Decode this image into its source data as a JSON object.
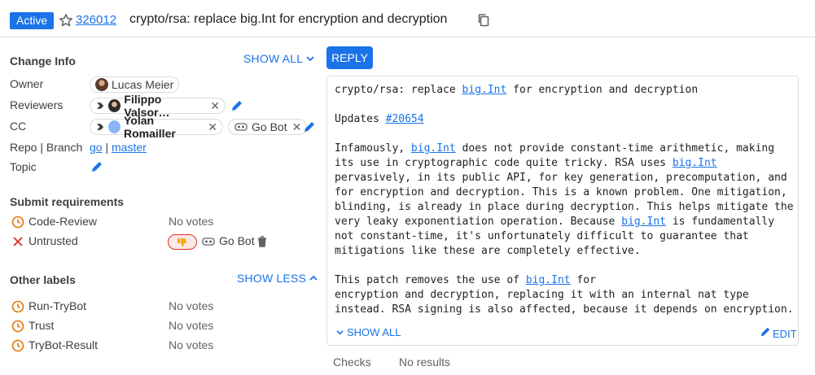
{
  "header": {
    "status": "Active",
    "change_number": "326012",
    "subject": "crypto/rsa: replace big.Int for encryption and decryption"
  },
  "change_info": {
    "title": "Change Info",
    "show_all": "SHOW ALL",
    "owner_label": "Owner",
    "owner": "Lucas Meier",
    "reviewers_label": "Reviewers",
    "reviewer": "Filippo Valsor…",
    "cc_label": "CC",
    "cc_person": "Yolan Romailler",
    "cc_bot": "Go Bot",
    "repo_label": "Repo | Branch",
    "repo": "go",
    "branch": "master",
    "topic_label": "Topic"
  },
  "submit_requirements": {
    "title": "Submit requirements",
    "items": [
      {
        "label": "Code-Review",
        "value": "No votes",
        "icon": "clock-icon"
      },
      {
        "label": "Untrusted",
        "value": "Go Bot",
        "icon": "close-icon"
      }
    ]
  },
  "other_labels": {
    "title": "Other labels",
    "show_less": "SHOW LESS",
    "items": [
      {
        "label": "Run-TryBot",
        "value": "No votes"
      },
      {
        "label": "Trust",
        "value": "No votes"
      },
      {
        "label": "TryBot-Result",
        "value": "No votes"
      }
    ]
  },
  "reply": "REPLY",
  "message": {
    "line1_a": "crypto/rsa: replace ",
    "bigint": "big.Int",
    "line1_b": " for encryption and decryption",
    "updates": "Updates ",
    "issue": "#20654",
    "p2_a": "Infamously, ",
    "p2_b": " does not provide constant-time arithmetic, making\nits use in cryptographic code quite tricky. RSA uses ",
    "p2_c": "\npervasively, in its public API, for key generation, precomputation, and\nfor encryption and decryption. This is a known problem. One mitigation,\nblinding, is already in place during decryption. This helps mitigate the\nvery leaky exponentiation operation. Because ",
    "p2_d": " is fundamentally\nnot constant-time, it's unfortunately difficult to guarantee that\nmitigations like these are completely effective.",
    "p3_a": "This patch removes the use of ",
    "p3_b": " for\nencryption and decryption, replacing it with an internal nat type\ninstead. RSA signing is also affected, because it depends on encryption.",
    "show_all": "SHOW ALL",
    "edit": "EDIT"
  },
  "checks": {
    "label": "Checks",
    "value": "No results"
  },
  "colors": {
    "accent": "#1a73e8",
    "warning": "#e37400",
    "error": "#d93025"
  }
}
